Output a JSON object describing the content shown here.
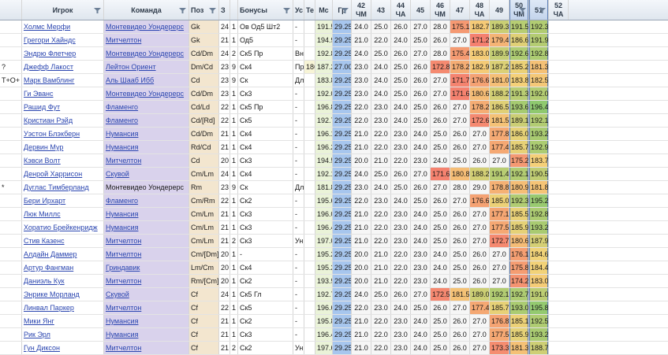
{
  "columns": [
    "",
    "Игрок",
    "Команда",
    "Поз",
    "З",
    "",
    "Бонусы",
    "Ус",
    "Те",
    "Мс",
    "Гр",
    "42 ЧМ",
    "43",
    "44 ЧА",
    "45",
    "46 ЧМ",
    "47",
    "48 ЧА",
    "49",
    "50 ЧМ",
    "51",
    "52 ЧА"
  ],
  "rows": [
    {
      "m": "",
      "name": "Холмс Мерфи",
      "team": "Монтевидео Уондерерс",
      "link": true,
      "pos": "Gk",
      "a": "24",
      "b": "1",
      "bonus": "Ов Од5 Шт2",
      "us": "-",
      "te": "",
      "v": [
        "191.5",
        "29.25",
        "24.0",
        "25.0",
        "26.0",
        "27.0",
        "28.0",
        "175.1",
        "182.7",
        "189.3",
        "191.5",
        "192.3"
      ]
    },
    {
      "m": "",
      "name": "Грегори Хайндс",
      "team": "Митчелтон",
      "link": true,
      "pos": "Gk",
      "a": "21",
      "b": "1",
      "bonus": "Од5",
      "us": "-",
      "te": "",
      "v": [
        "194.9",
        "29.25",
        "21.0",
        "22.0",
        "24.0",
        "25.0",
        "26.0",
        "27.0",
        "171.2",
        "179.4",
        "186.6",
        "191.9"
      ]
    },
    {
      "m": "",
      "name": "Эндрю Флетчер",
      "team": "Монтевидео Уондерерс",
      "link": true,
      "pos": "Cd/Dm",
      "a": "24",
      "b": "2",
      "bonus": "Ск5 Пр",
      "us": "Вн",
      "te": "",
      "v": [
        "192.8",
        "29.25",
        "24.0",
        "25.0",
        "26.0",
        "27.0",
        "28.0",
        "175.4",
        "183.0",
        "189.9",
        "192.6",
        "192.8"
      ]
    },
    {
      "m": "?",
      "name": "Джефф Лакост",
      "team": "Лейтон Ориент",
      "link": true,
      "pos": "Dm/Cd",
      "a": "23",
      "b": "9",
      "bonus": "Ск4",
      "us": "Пр",
      "te": "186.0",
      "v": [
        "187.2",
        "27.00",
        "23.0",
        "24.0",
        "25.0",
        "26.0",
        "172.8",
        "178.2",
        "182.9",
        "187.2",
        "185.2",
        "181.3"
      ]
    },
    {
      "m": "Т+О+",
      "name": "Марк Вамблинг",
      "team": "Аль Шааб Ибб",
      "link": true,
      "pos": "Cd",
      "a": "23",
      "b": "9",
      "bonus": "Ск",
      "us": "Дл",
      "te": "",
      "v": [
        "183.8",
        "29.25",
        "23.0",
        "24.0",
        "25.0",
        "26.0",
        "27.0",
        "171.7",
        "176.6",
        "181.0",
        "183.8",
        "182.5"
      ]
    },
    {
      "m": "",
      "name": "Ги Эванс",
      "team": "Монтевидео Уондерерс",
      "link": true,
      "pos": "Cd/Dm",
      "a": "23",
      "b": "1",
      "bonus": "Ск3",
      "us": "-",
      "te": "",
      "v": [
        "192.0",
        "29.25",
        "23.0",
        "24.0",
        "25.0",
        "26.0",
        "27.0",
        "171.6",
        "180.6",
        "188.2",
        "191.3",
        "192.0"
      ]
    },
    {
      "m": "",
      "name": "Рашид Фут",
      "team": "Фламенго",
      "link": true,
      "pos": "Cd/Ld",
      "a": "22",
      "b": "1",
      "bonus": "Ск5 Пр",
      "us": "-",
      "te": "",
      "v": [
        "196.8",
        "29.25",
        "22.0",
        "23.0",
        "24.0",
        "25.0",
        "26.0",
        "27.0",
        "178.2",
        "186.5",
        "193.6",
        "196.4"
      ]
    },
    {
      "m": "",
      "name": "Кристиан Рэйд",
      "team": "Фламенго",
      "link": true,
      "pos": "Cd/[Rd]",
      "a": "22",
      "b": "1",
      "bonus": "Ск5",
      "us": "-",
      "te": "",
      "v": [
        "192.7",
        "29.25",
        "22.0",
        "23.0",
        "24.0",
        "25.0",
        "26.0",
        "27.0",
        "172.6",
        "181.5",
        "189.1",
        "192.1"
      ]
    },
    {
      "m": "",
      "name": "Уэстон Блэкберн",
      "team": "Нумансия",
      "link": true,
      "pos": "Cd/Dm",
      "a": "21",
      "b": "1",
      "bonus": "Ск4",
      "us": "-",
      "te": "",
      "v": [
        "196.1",
        "29.25",
        "21.0",
        "22.0",
        "23.0",
        "24.0",
        "25.0",
        "26.0",
        "27.0",
        "177.8",
        "186.0",
        "193.2"
      ]
    },
    {
      "m": "",
      "name": "Дервин Мур",
      "team": "Нумансия",
      "link": true,
      "pos": "Rd/Cd",
      "a": "21",
      "b": "1",
      "bonus": "Ск4",
      "us": "-",
      "te": "",
      "v": [
        "196.2",
        "29.25",
        "21.0",
        "22.0",
        "23.0",
        "24.0",
        "25.0",
        "26.0",
        "27.0",
        "177.4",
        "185.7",
        "192.9"
      ]
    },
    {
      "m": "",
      "name": "Кэвси Волт",
      "team": "Митчелтон",
      "link": true,
      "pos": "Cd",
      "a": "20",
      "b": "1",
      "bonus": "Ск3",
      "us": "-",
      "te": "",
      "v": [
        "194.5",
        "29.25",
        "20.0",
        "21.0",
        "22.0",
        "23.0",
        "24.0",
        "25.0",
        "26.0",
        "27.0",
        "175.2",
        "183.7"
      ]
    },
    {
      "m": "",
      "name": "Денрой Харрисон",
      "team": "Скувой",
      "link": true,
      "pos": "Cm/Lm",
      "a": "24",
      "b": "1",
      "bonus": "Ск4",
      "us": "-",
      "te": "",
      "v": [
        "192.1",
        "29.25",
        "24.0",
        "25.0",
        "26.0",
        "27.0",
        "171.6",
        "180.8",
        "188.2",
        "191.4",
        "192.1",
        "190.5"
      ]
    },
    {
      "m": "*",
      "name": "Дуглас Тимберланд",
      "team": "Монтевидео Уондерерс",
      "link": false,
      "pos": "Rm",
      "a": "23",
      "b": "9",
      "bonus": "Ск",
      "us": "Дл",
      "te": "",
      "v": [
        "181.8",
        "29.25",
        "23.0",
        "24.0",
        "25.0",
        "26.0",
        "27.0",
        "28.0",
        "29.0",
        "178.8",
        "180.9",
        "181.8"
      ]
    },
    {
      "m": "",
      "name": "Бери Ирхарт",
      "team": "Фламенго",
      "link": true,
      "pos": "Cm/Rm",
      "a": "22",
      "b": "1",
      "bonus": "Ск2",
      "us": "-",
      "te": "",
      "v": [
        "195.6",
        "29.25",
        "22.0",
        "23.0",
        "24.0",
        "25.0",
        "26.0",
        "27.0",
        "176.6",
        "185.0",
        "192.3",
        "195.2"
      ]
    },
    {
      "m": "",
      "name": "Люк Миллс",
      "team": "Нумансия",
      "link": true,
      "pos": "Cm/Lm",
      "a": "21",
      "b": "1",
      "bonus": "Ск3",
      "us": "-",
      "te": "",
      "v": [
        "196.0",
        "29.25",
        "21.0",
        "22.0",
        "23.0",
        "24.0",
        "25.0",
        "26.0",
        "27.0",
        "177.1",
        "185.5",
        "192.8"
      ]
    },
    {
      "m": "",
      "name": "Хоратио Брейкенридж",
      "team": "Нумансия",
      "link": true,
      "pos": "Cm/Lm",
      "a": "21",
      "b": "1",
      "bonus": "Ск3",
      "us": "-",
      "te": "",
      "v": [
        "196.4",
        "29.25",
        "21.0",
        "22.0",
        "23.0",
        "24.0",
        "25.0",
        "26.0",
        "27.0",
        "177.5",
        "185.9",
        "193.2"
      ]
    },
    {
      "m": "",
      "name": "Стив Казенс",
      "team": "Митчелтон",
      "link": true,
      "pos": "Cm/Lm",
      "a": "21",
      "b": "2",
      "bonus": "Ск3",
      "us": "Ун",
      "te": "",
      "v": [
        "197.0",
        "29.25",
        "21.0",
        "22.0",
        "23.0",
        "24.0",
        "25.0",
        "26.0",
        "27.0",
        "172.7",
        "180.6",
        "187.9"
      ]
    },
    {
      "m": "",
      "name": "Алдайн Даммер",
      "team": "Митчелтон",
      "link": true,
      "pos": "Cm/[Dm]",
      "a": "20",
      "b": "1",
      "bonus": "-",
      "us": "-",
      "te": "",
      "v": [
        "195.2",
        "29.25",
        "20.0",
        "21.0",
        "22.0",
        "23.0",
        "24.0",
        "25.0",
        "26.0",
        "27.0",
        "176.1",
        "184.6"
      ]
    },
    {
      "m": "",
      "name": "Артур Фангман",
      "team": "Гриндавик",
      "link": true,
      "pos": "Lm/Cm",
      "a": "20",
      "b": "1",
      "bonus": "Ск4",
      "us": "-",
      "te": "",
      "v": [
        "195.2",
        "29.25",
        "20.0",
        "21.0",
        "22.0",
        "23.0",
        "24.0",
        "25.0",
        "26.0",
        "27.0",
        "175.8",
        "184.4"
      ]
    },
    {
      "m": "",
      "name": "Даниэль Кук",
      "team": "Митчелтон",
      "link": true,
      "pos": "Rm/[Cm]",
      "a": "20",
      "b": "1",
      "bonus": "Ск2",
      "us": "-",
      "te": "",
      "v": [
        "193.9",
        "29.25",
        "20.0",
        "21.0",
        "22.0",
        "23.0",
        "24.0",
        "25.0",
        "26.0",
        "27.0",
        "174.2",
        "183.0"
      ]
    },
    {
      "m": "",
      "name": "Энрике Морланд",
      "team": "Скувой",
      "link": true,
      "pos": "Cf",
      "a": "24",
      "b": "1",
      "bonus": "Ск5 Гл",
      "us": "-",
      "te": "",
      "v": [
        "192.7",
        "29.25",
        "24.0",
        "25.0",
        "26.0",
        "27.0",
        "172.5",
        "181.5",
        "189.0",
        "192.1",
        "192.7",
        "191.0"
      ]
    },
    {
      "m": "",
      "name": "Линвал Паркер",
      "team": "Митчелтон",
      "link": true,
      "pos": "Cf",
      "a": "22",
      "b": "1",
      "bonus": "Ск5",
      "us": "-",
      "te": "",
      "v": [
        "196.6",
        "29.25",
        "22.0",
        "23.0",
        "24.0",
        "25.0",
        "26.0",
        "27.0",
        "177.4",
        "185.7",
        "193.0",
        "195.8"
      ]
    },
    {
      "m": "",
      "name": "Мики Янг",
      "team": "Нумансия",
      "link": true,
      "pos": "Cf",
      "a": "21",
      "b": "1",
      "bonus": "Ск2",
      "us": "-",
      "te": "",
      "v": [
        "195.8",
        "29.25",
        "21.0",
        "22.0",
        "23.0",
        "24.0",
        "25.0",
        "26.0",
        "27.0",
        "176.8",
        "185.1",
        "192.5"
      ]
    },
    {
      "m": "",
      "name": "Рик Эрл",
      "team": "Нумансия",
      "link": true,
      "pos": "Cf",
      "a": "21",
      "b": "1",
      "bonus": "Ск3",
      "us": "-",
      "te": "",
      "v": [
        "196.4",
        "29.25",
        "21.0",
        "22.0",
        "23.0",
        "24.0",
        "25.0",
        "26.0",
        "27.0",
        "177.5",
        "185.9",
        "193.2"
      ]
    },
    {
      "m": "",
      "name": "Гун Диксон",
      "team": "Митчелтон",
      "link": true,
      "pos": "Cf",
      "a": "21",
      "b": "2",
      "bonus": "Ск2",
      "us": "Ун",
      "te": "",
      "v": [
        "197.6",
        "29.25",
        "21.0",
        "22.0",
        "23.0",
        "24.0",
        "25.0",
        "26.0",
        "27.0",
        "173.3",
        "181.3",
        "188.7"
      ]
    }
  ]
}
